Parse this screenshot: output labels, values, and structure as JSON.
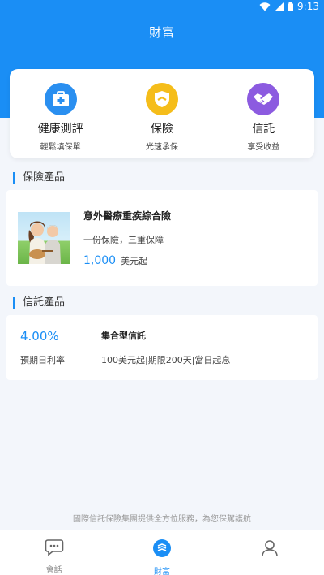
{
  "status_bar": {
    "time": "9:13"
  },
  "header": {
    "title": "財富"
  },
  "quick_actions": [
    {
      "label": "健康測評",
      "sub": "輕鬆填保單",
      "icon": "medical-kit-icon",
      "color": "#2a8ff0"
    },
    {
      "label": "保險",
      "sub": "光速承保",
      "icon": "shield-icon",
      "color": "#f5bd1a"
    },
    {
      "label": "信託",
      "sub": "享受收益",
      "icon": "handshake-icon",
      "color": "#8c5be0"
    }
  ],
  "insurance_section": {
    "title": "保險產品",
    "product": {
      "name": "意外醫療重疾綜合險",
      "desc": "一份保險，三重保障",
      "price": "1,000",
      "price_unit": "美元起"
    }
  },
  "trust_section": {
    "title": "信託產品",
    "product": {
      "rate": "4.00%",
      "rate_label": "預期日利率",
      "name": "集合型信託",
      "desc": "100美元起|期限200天|當日起息"
    }
  },
  "footer_note": "國際信託保險集團提供全方位服務，為您保駕護航",
  "tabs": [
    {
      "label": "會話",
      "icon": "chat-icon",
      "active": false
    },
    {
      "label": "財富",
      "icon": "wealth-icon",
      "active": true
    },
    {
      "label": "",
      "icon": "profile-icon",
      "active": false
    }
  ],
  "colors": {
    "accent": "#1a8ef5",
    "background": "#f3f6fb"
  }
}
